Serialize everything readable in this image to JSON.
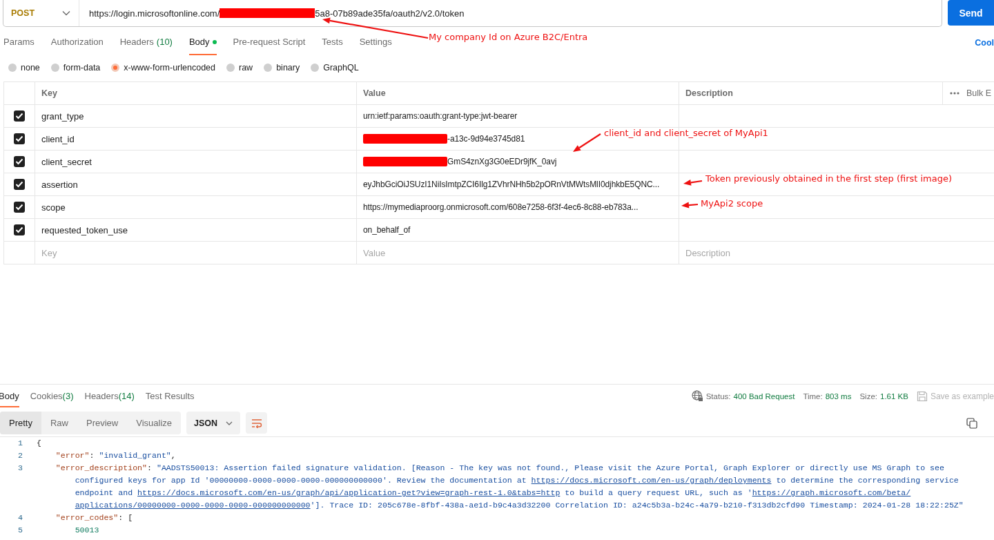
{
  "request": {
    "method": "POST",
    "url_parts": [
      {
        "kind": "text",
        "text": "https://login.microsoftonline.com/"
      },
      {
        "kind": "redacted"
      },
      {
        "kind": "text",
        "text": "5a8-07b89ade35fa/oauth2/v2.0/token"
      }
    ],
    "send_label": "Send"
  },
  "request_tabs": [
    {
      "label": "Params",
      "selected": false
    },
    {
      "label": "Authorization",
      "selected": false
    },
    {
      "label": "Headers",
      "count": "(10)",
      "selected": false
    },
    {
      "label": "Body",
      "selected": true,
      "has_content": true
    },
    {
      "label": "Pre-request Script",
      "selected": false
    },
    {
      "label": "Tests",
      "selected": false
    },
    {
      "label": "Settings",
      "selected": false
    }
  ],
  "cookies_link": "Cool",
  "body_types": [
    {
      "label": "none",
      "selected": false
    },
    {
      "label": "form-data",
      "selected": false
    },
    {
      "label": "x-www-form-urlencoded",
      "selected": true
    },
    {
      "label": "raw",
      "selected": false
    },
    {
      "label": "binary",
      "selected": false
    },
    {
      "label": "GraphQL",
      "selected": false
    }
  ],
  "params_table": {
    "columns": [
      "Key",
      "Value",
      "Description"
    ],
    "bulk_edit": "Bulk E",
    "rows": [
      {
        "checked": true,
        "key": "grant_type",
        "value": [
          {
            "kind": "text",
            "text": "urn:ietf:params:oauth:grant-type:jwt-bearer"
          }
        ]
      },
      {
        "checked": true,
        "key": "client_id",
        "value": [
          {
            "kind": "redacted"
          },
          {
            "kind": "text",
            "text": "-a13c-9d94e3745d81"
          }
        ]
      },
      {
        "checked": true,
        "key": "client_secret",
        "value": [
          {
            "kind": "redacted"
          },
          {
            "kind": "text",
            "text": "GmS4znXg3G0eEDr9jfK_0avj"
          }
        ]
      },
      {
        "checked": true,
        "key": "assertion",
        "value": [
          {
            "kind": "text",
            "text": "eyJhbGciOiJSUzI1NiIsImtpZCI6Ilg1ZVhrNHh5b2pORnVtMWtsMlI0djhkbE5QNC..."
          }
        ]
      },
      {
        "checked": true,
        "key": "scope",
        "value": [
          {
            "kind": "text",
            "text": "https://mymediaproorg.onmicrosoft.com/608e7258-6f3f-4ec6-8c88-eb783a..."
          }
        ]
      },
      {
        "checked": true,
        "key": "requested_token_use",
        "value": [
          {
            "kind": "text",
            "text": "on_behalf_of"
          }
        ]
      }
    ],
    "placeholder_row": {
      "key": "Key",
      "value": "Value",
      "description": "Description"
    }
  },
  "response": {
    "tabs": [
      {
        "label": "Body",
        "selected": true
      },
      {
        "label": "Cookies",
        "count": "(3)",
        "selected": false
      },
      {
        "label": "Headers",
        "count": "(14)",
        "selected": false
      },
      {
        "label": "Test Results",
        "selected": false
      }
    ],
    "status_label": "Status:",
    "status": "400 Bad Request",
    "time_label": "Time:",
    "time": "803 ms",
    "size_label": "Size:",
    "size": "1.61 KB",
    "save_example": "Save as example",
    "view_modes": [
      {
        "label": "Pretty",
        "selected": true
      },
      {
        "label": "Raw",
        "selected": false
      },
      {
        "label": "Preview",
        "selected": false
      },
      {
        "label": "Visualize",
        "selected": false
      }
    ],
    "format": "JSON",
    "code_lines": [
      {
        "number": "1",
        "rows": [
          [
            {
              "kind": "punct",
              "text": "{"
            }
          ]
        ]
      },
      {
        "number": "2",
        "rows": [
          [
            {
              "kind": "key",
              "text": "    \"error\""
            },
            {
              "kind": "punct",
              "text": ": "
            },
            {
              "kind": "string",
              "text": "\"invalid_grant\""
            },
            {
              "kind": "punct",
              "text": ","
            }
          ]
        ]
      },
      {
        "number": "3",
        "rows": [
          [
            {
              "kind": "key",
              "text": "    \"error_description\""
            },
            {
              "kind": "punct",
              "text": ": "
            },
            {
              "kind": "string",
              "text": "\"AADSTS50013: Assertion failed signature validation. [Reason - The key was not found., Please visit the Azure Portal, Graph Explorer or directly use MS Graph to see"
            }
          ],
          [
            {
              "kind": "string",
              "text": "configured keys for app Id '00000000-0000-0000-0000-000000000000'. Review the documentation at "
            },
            {
              "kind": "link",
              "text": "https://docs.microsoft.com/en-us/graph/deployments"
            },
            {
              "kind": "string",
              "text": " to determine the corresponding service"
            }
          ],
          [
            {
              "kind": "string",
              "text": "endpoint and "
            },
            {
              "kind": "link",
              "text": "https://docs.microsoft.com/en-us/graph/api/application-get?view=graph-rest-1.0&tabs=http"
            },
            {
              "kind": "string",
              "text": " to build a query request URL, such as '"
            },
            {
              "kind": "link",
              "text": "https://graph.microsoft.com/beta/"
            }
          ],
          [
            {
              "kind": "link",
              "text": "applications/00000000-0000-0000-0000-000000000000"
            },
            {
              "kind": "string",
              "text": "']. Trace ID: 205c678e-8fbf-438a-ae1d-b9c4a3d32200 Correlation ID: a24c5b3a-b24c-4a79-b210-f313db2cfd90 Timestamp: 2024-01-28 18:22:25Z\""
            }
          ]
        ]
      },
      {
        "number": "4",
        "rows": [
          [
            {
              "kind": "key",
              "text": "    \"error_codes\""
            },
            {
              "kind": "punct",
              "text": ": ["
            }
          ]
        ]
      },
      {
        "number": "5",
        "rows": [
          [
            {
              "kind": "number",
              "text": "        50013"
            }
          ]
        ]
      }
    ]
  },
  "annotations": [
    {
      "text": "My company Id on Azure B2C/Entra"
    },
    {
      "text": "client_id and client_secret of MyApi1"
    },
    {
      "text": "Token previously obtained in the first step (first image)"
    },
    {
      "text": "MyApi2 scope"
    }
  ]
}
